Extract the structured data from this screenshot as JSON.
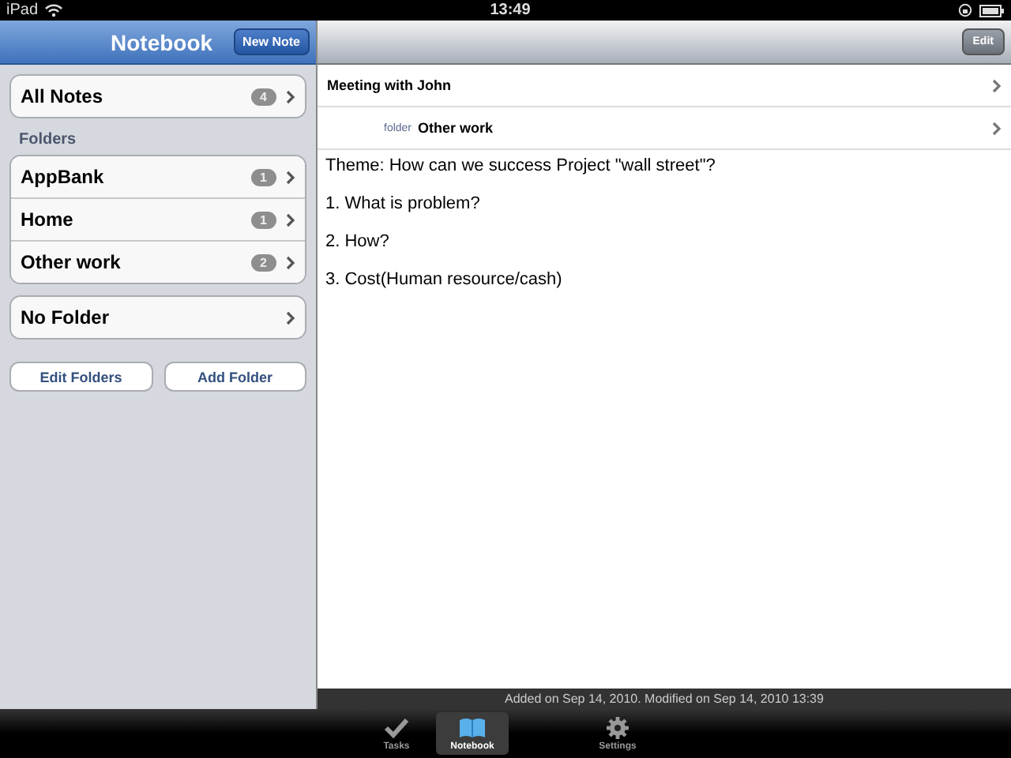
{
  "status_bar": {
    "device": "iPad",
    "time": "13:49"
  },
  "sidebar": {
    "title": "Notebook",
    "new_button": "New Note",
    "all_notes": {
      "label": "All Notes",
      "count": "4"
    },
    "folders_heading": "Folders",
    "folders": [
      {
        "label": "AppBank",
        "count": "1"
      },
      {
        "label": "Home",
        "count": "1"
      },
      {
        "label": "Other work",
        "count": "2"
      }
    ],
    "no_folder": {
      "label": "No Folder"
    },
    "buttons": [
      "Edit Folders",
      "Add Folder"
    ]
  },
  "note": {
    "edit_button": "Edit",
    "title": "Meeting with John",
    "folder_label": "folder",
    "folder": "Other work",
    "lines": [
      "Theme: How can we success Project \"wall street\"?",
      "1. What is problem?",
      "2. How?",
      "3. Cost(Human resource/cash)"
    ],
    "footer": "Added on Sep 14, 2010.   Modified on Sep 14, 2010 13:39"
  },
  "tab_bar": [
    {
      "label": "Tasks",
      "kind": "check",
      "selected": false
    },
    {
      "label": "Notebook",
      "kind": "book",
      "selected": true
    },
    {
      "label": "Settings",
      "kind": "gear",
      "selected": false
    }
  ]
}
